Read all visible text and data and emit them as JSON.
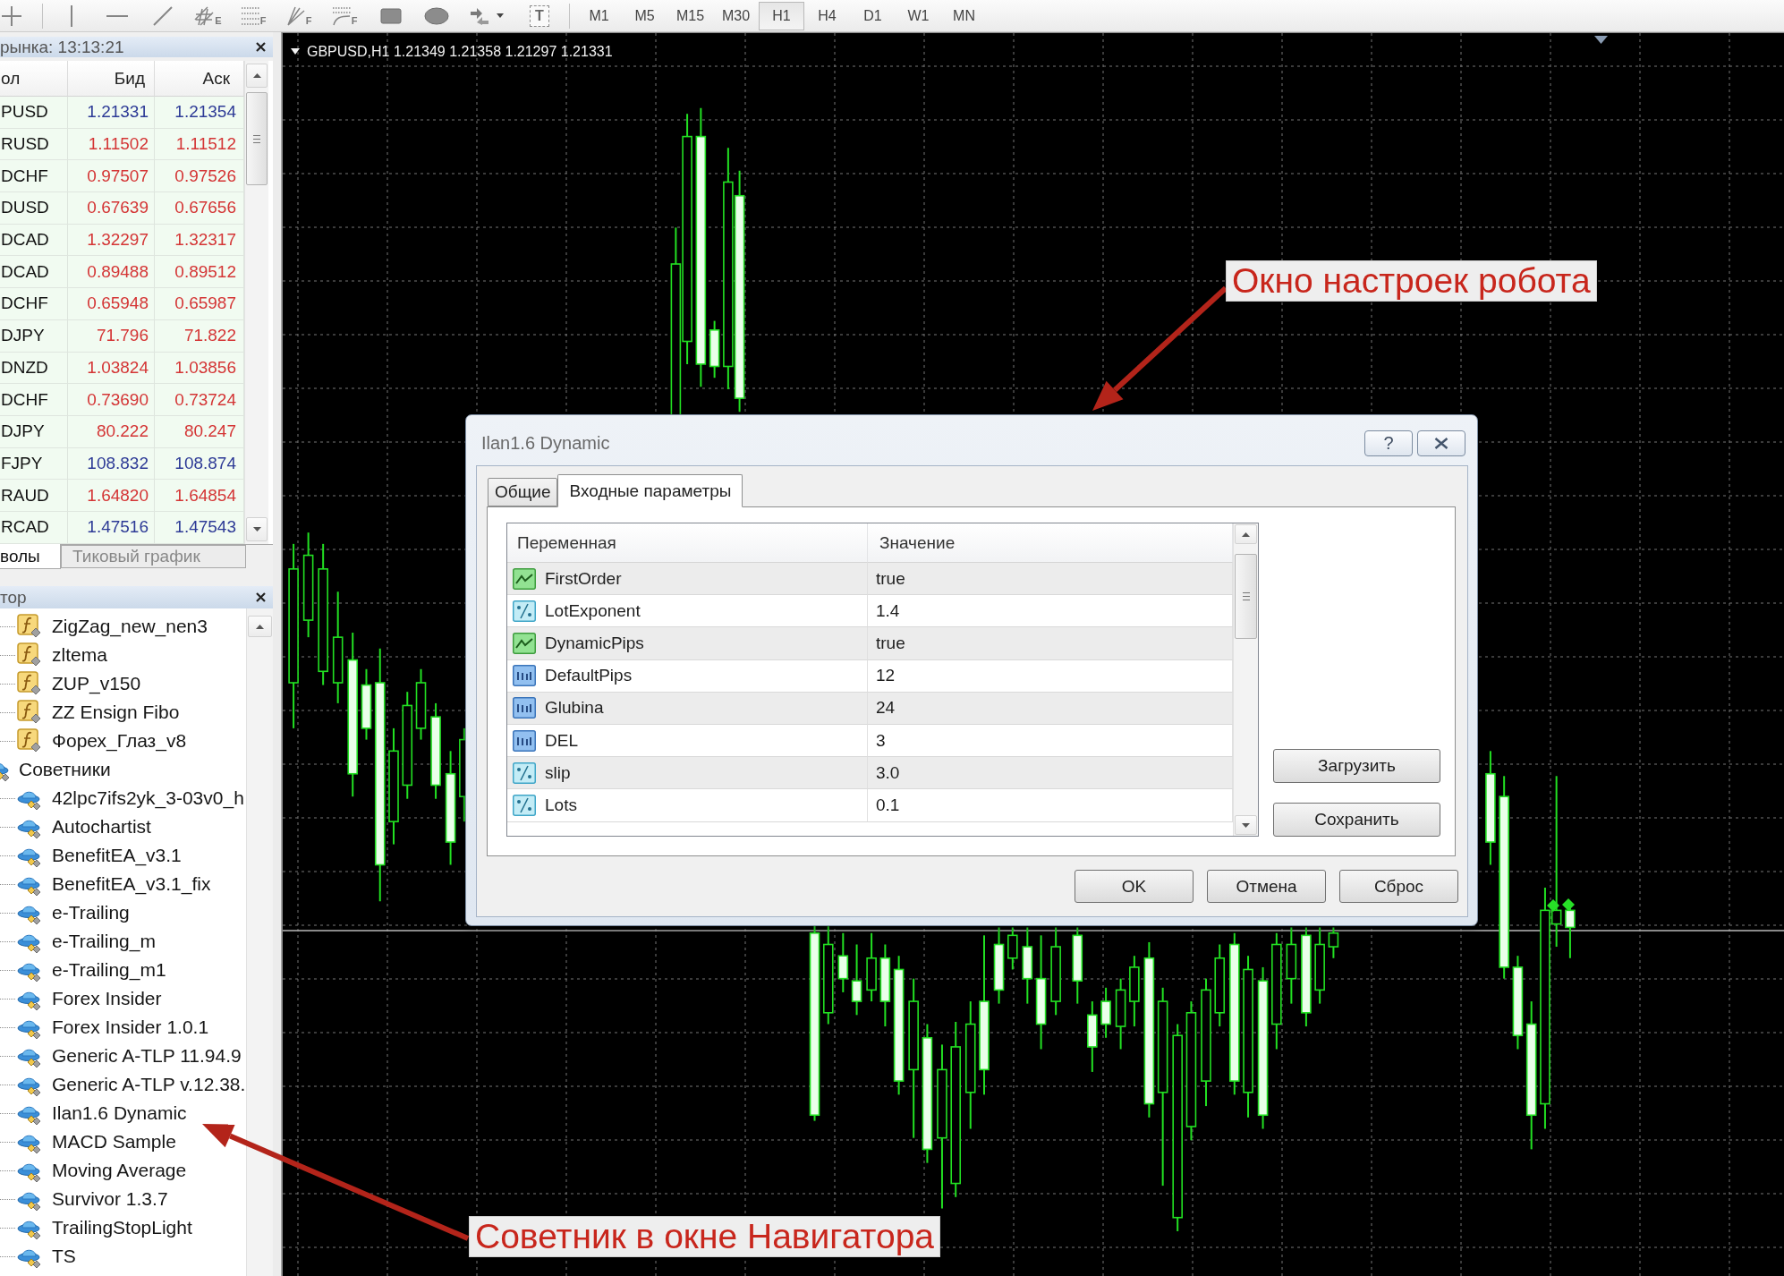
{
  "toolbar": {
    "tools": [
      {
        "kind": "crosshair"
      },
      {
        "kind": "vertical-line"
      },
      {
        "kind": "horizontal-line"
      },
      {
        "kind": "trend-line"
      },
      {
        "kind": "channel",
        "letter": "E"
      },
      {
        "kind": "fibo",
        "letter": "F"
      },
      {
        "kind": "gann",
        "letter": "F"
      },
      {
        "kind": "fan",
        "letter": "F"
      },
      {
        "kind": "rectangle"
      },
      {
        "kind": "ellipse"
      },
      {
        "kind": "arrows"
      },
      {
        "kind": "text",
        "letter": "T"
      }
    ],
    "timeframes": [
      {
        "label": "M1",
        "selected": false
      },
      {
        "label": "M5",
        "selected": false
      },
      {
        "label": "M15",
        "selected": false
      },
      {
        "label": "M30",
        "selected": false
      },
      {
        "label": "H1",
        "selected": true
      },
      {
        "label": "H4",
        "selected": false
      },
      {
        "label": "D1",
        "selected": false
      },
      {
        "label": "W1",
        "selected": false
      },
      {
        "label": "MN",
        "selected": false
      }
    ]
  },
  "market_watch": {
    "title": "рынка: 13:13:21",
    "columns": [
      "ол",
      "Бид",
      "Аск"
    ],
    "rows": [
      {
        "symbol": "PUSD",
        "bid": "1.21331",
        "ask": "1.21354",
        "color": "#2d3a96"
      },
      {
        "symbol": "RUSD",
        "bid": "1.11502",
        "ask": "1.11512",
        "color": "#d43535"
      },
      {
        "symbol": "DCHF",
        "bid": "0.97507",
        "ask": "0.97526",
        "color": "#d43535"
      },
      {
        "symbol": "DUSD",
        "bid": "0.67639",
        "ask": "0.67656",
        "color": "#d43535"
      },
      {
        "symbol": "DCAD",
        "bid": "1.32297",
        "ask": "1.32317",
        "color": "#d43535"
      },
      {
        "symbol": "DCAD",
        "bid": "0.89488",
        "ask": "0.89512",
        "color": "#d43535"
      },
      {
        "symbol": "DCHF",
        "bid": "0.65948",
        "ask": "0.65987",
        "color": "#d43535"
      },
      {
        "symbol": "DJPY",
        "bid": "71.796",
        "ask": "71.822",
        "color": "#d43535"
      },
      {
        "symbol": "DNZD",
        "bid": "1.03824",
        "ask": "1.03856",
        "color": "#d43535"
      },
      {
        "symbol": "DCHF",
        "bid": "0.73690",
        "ask": "0.73724",
        "color": "#d43535"
      },
      {
        "symbol": "DJPY",
        "bid": "80.222",
        "ask": "80.247",
        "color": "#d43535"
      },
      {
        "symbol": "FJPY",
        "bid": "108.832",
        "ask": "108.874",
        "color": "#2d3a96"
      },
      {
        "symbol": "RAUD",
        "bid": "1.64820",
        "ask": "1.64854",
        "color": "#d43535"
      },
      {
        "symbol": "RCAD",
        "bid": "1.47516",
        "ask": "1.47543",
        "color": "#2d3a96"
      }
    ],
    "tabs": [
      {
        "label": "волы",
        "selected": true
      },
      {
        "label": "Тиковый график",
        "selected": false
      }
    ]
  },
  "navigator": {
    "title": "тор",
    "items": [
      {
        "children": [
          {
            "label": "ZigZag_new_nen3",
            "kind": "indicator"
          },
          {
            "label": "zltema",
            "kind": "indicator"
          },
          {
            "label": "ZUP_v150",
            "kind": "indicator"
          },
          {
            "label": "ZZ Ensign Fibo",
            "kind": "indicator"
          },
          {
            "label": "Форех_Глаз_v8",
            "kind": "indicator"
          }
        ]
      },
      {
        "label": "Советники",
        "kind": "expert",
        "children": [
          {
            "label": "42lpc7ifs2yk_3-03v0_h",
            "kind": "expert"
          },
          {
            "label": "Autochartist",
            "kind": "expert"
          },
          {
            "label": "BenefitEA_v3.1",
            "kind": "expert"
          },
          {
            "label": "BenefitEA_v3.1_fix",
            "kind": "expert"
          },
          {
            "label": "e-Trailing",
            "kind": "expert"
          },
          {
            "label": "e-Trailing_m",
            "kind": "expert"
          },
          {
            "label": "e-Trailing_m1",
            "kind": "expert"
          },
          {
            "label": "Forex Insider",
            "kind": "expert"
          },
          {
            "label": "Forex Insider 1.0.1",
            "kind": "expert"
          },
          {
            "label": "Generic A-TLP 11.94.9",
            "kind": "expert"
          },
          {
            "label": "Generic A-TLP v.12.38.",
            "kind": "expert"
          },
          {
            "label": "Ilan1.6 Dynamic",
            "kind": "expert"
          },
          {
            "label": "MACD Sample",
            "kind": "expert"
          },
          {
            "label": "Moving Average",
            "kind": "expert"
          },
          {
            "label": "Survivor 1.3.7",
            "kind": "expert"
          },
          {
            "label": "TrailingStopLight",
            "kind": "expert"
          },
          {
            "label": "TS",
            "kind": "expert"
          }
        ]
      }
    ]
  },
  "chart": {
    "title": "GBPUSD,H1 1.21349 1.21358 1.21297 1.21331"
  },
  "dialog": {
    "title": "Ilan1.6 Dynamic",
    "help_button": "?",
    "tabs": [
      {
        "label": "Общие",
        "selected": false
      },
      {
        "label": "Входные параметры",
        "selected": true
      }
    ],
    "columns": [
      "Переменная",
      "Значение"
    ],
    "rows": [
      {
        "name": "FirstOrder",
        "value": "true",
        "kind": "bool"
      },
      {
        "name": "LotExponent",
        "value": "1.4",
        "kind": "double"
      },
      {
        "name": "DynamicPips",
        "value": "true",
        "kind": "bool"
      },
      {
        "name": "DefaultPips",
        "value": "12",
        "kind": "int"
      },
      {
        "name": "Glubina",
        "value": "24",
        "kind": "int"
      },
      {
        "name": "DEL",
        "value": "3",
        "kind": "int"
      },
      {
        "name": "slip",
        "value": "3.0",
        "kind": "double"
      },
      {
        "name": "Lots",
        "value": "0.1",
        "kind": "double"
      }
    ],
    "side_buttons": [
      "Загрузить",
      "Сохранить"
    ],
    "buttons": [
      "OK",
      "Отмена",
      "Сброс"
    ]
  },
  "annotations": [
    {
      "text": "Окно настроек робота"
    },
    {
      "text": "Советник в окне Навигатора"
    }
  ]
}
